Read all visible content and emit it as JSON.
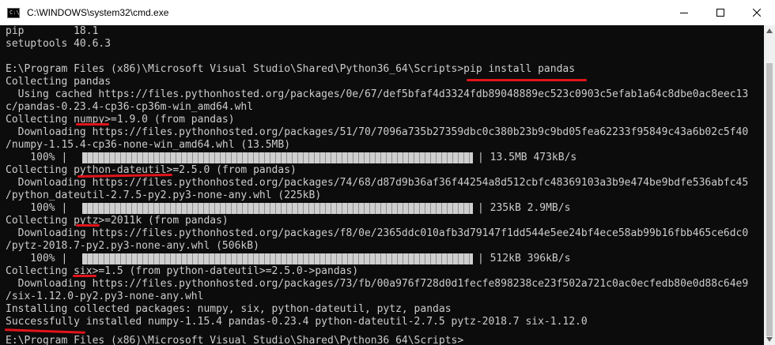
{
  "window": {
    "title": "C:\\WINDOWS\\system32\\cmd.exe",
    "icon_text": "C:\\"
  },
  "console": {
    "lines": [
      "pip        18.1",
      "setuptools 40.6.3",
      "",
      "E:\\Program Files (x86)\\Microsoft Visual Studio\\Shared\\Python36_64\\Scripts>pip install pandas",
      "Collecting pandas",
      "  Using cached https://files.pythonhosted.org/packages/0e/67/def5bfaf4d3324fdb89048889ec523c0903c5efab1a64c8dbe0ac8eec13",
      "c/pandas-0.23.4-cp36-cp36m-win_amd64.whl",
      "Collecting numpy>=1.9.0 (from pandas)",
      "  Downloading https://files.pythonhosted.org/packages/51/70/7096a735b27359dbc0c380b23b9c9bd05fea62233f95849c43a6b02c5f40",
      "/numpy-1.15.4-cp36-none-win_amd64.whl (13.5MB)",
      "    100% |",
      "Collecting python-dateutil>=2.5.0 (from pandas)",
      "  Downloading https://files.pythonhosted.org/packages/74/68/d87d9b36af36f44254a8d512cbfc48369103a3b9e474be9bdfe536abfc45",
      "/python_dateutil-2.7.5-py2.py3-none-any.whl (225kB)",
      "    100% |",
      "Collecting pytz>=2011k (from pandas)",
      "  Downloading https://files.pythonhosted.org/packages/f8/0e/2365ddc010afb3d79147f1dd544e5ee24bf4ece58ab99b16fbb465ce6dc0",
      "/pytz-2018.7-py2.py3-none-any.whl (506kB)",
      "    100% |",
      "Collecting six>=1.5 (from python-dateutil>=2.5.0->pandas)",
      "  Downloading https://files.pythonhosted.org/packages/73/fb/00a976f728d0d1fecfe898238ce23f502a721c0ac0ecfedb80e0d88c64e9",
      "/six-1.12.0-py2.py3-none-any.whl",
      "Installing collected packages: numpy, six, python-dateutil, pytz, pandas",
      "Successfully installed numpy-1.15.4 pandas-0.23.4 python-dateutil-2.7.5 pytz-2018.7 six-1.12.0",
      "E:\\Program Files (x86)\\Microsoft Visual Studio\\Shared\\Python36_64\\Scripts>_"
    ],
    "progress": [
      {
        "percent": 100,
        "stats": "| 13.5MB 473kB/s"
      },
      {
        "percent": 100,
        "stats": "| 235kB 2.9MB/s"
      },
      {
        "percent": 100,
        "stats": "| 512kB 396kB/s"
      }
    ]
  },
  "colors": {
    "console_bg": "#0c0c0c",
    "console_text": "#cccccc",
    "progress_fill": "#c0c0c0",
    "annotation": "#e2141b"
  }
}
